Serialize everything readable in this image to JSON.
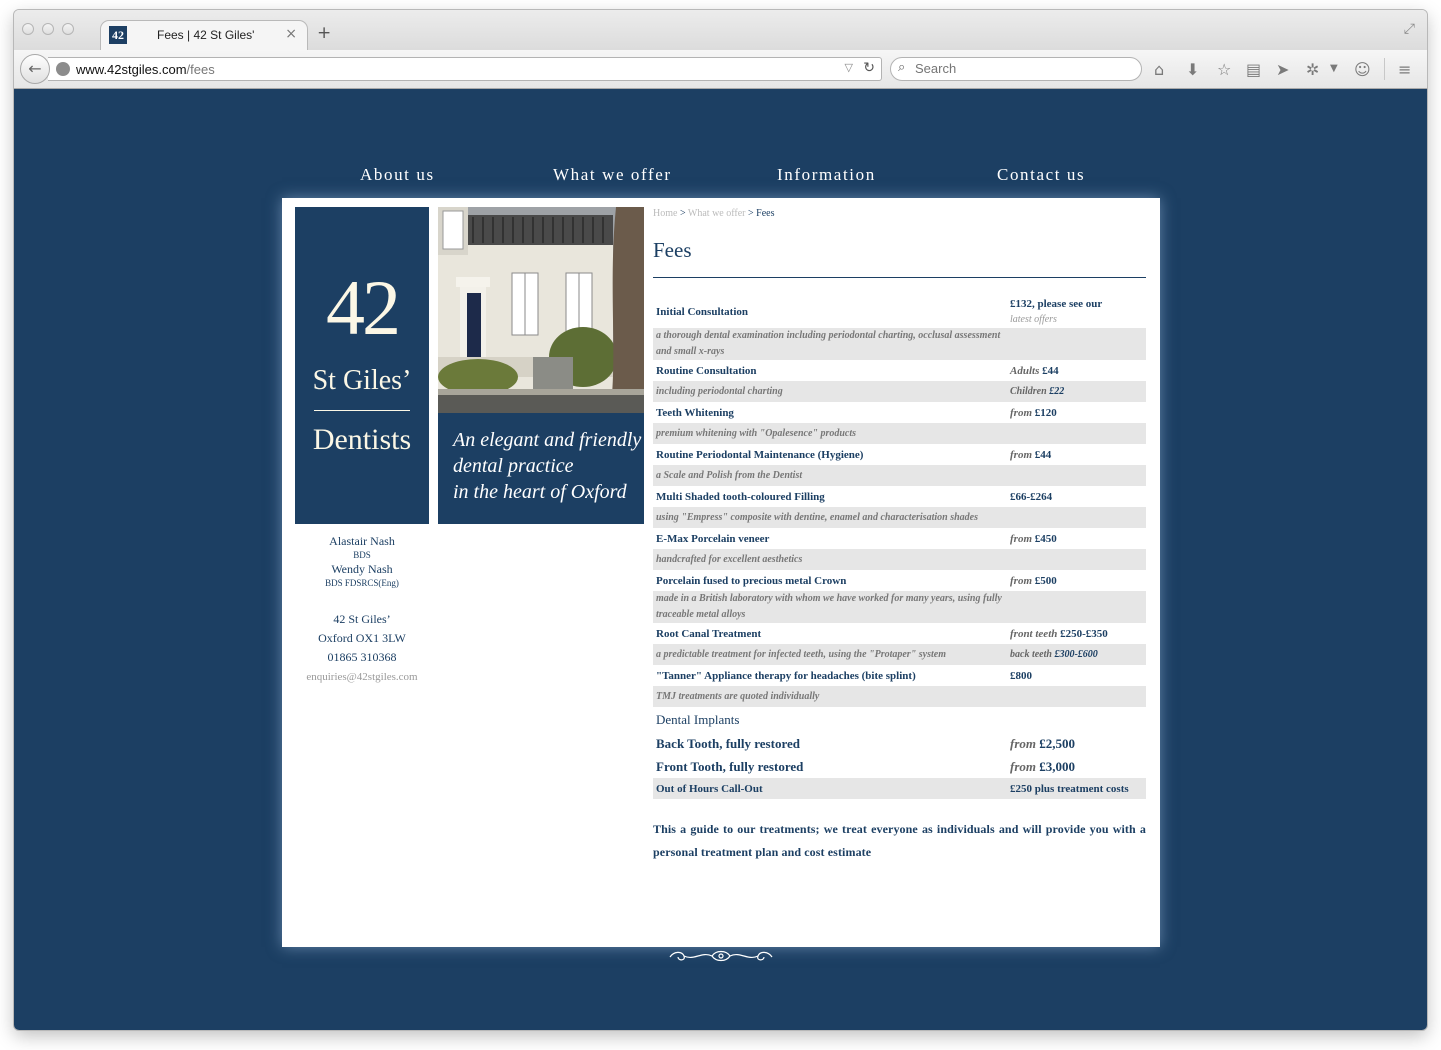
{
  "browser": {
    "tab_favicon_text": "42",
    "tab_title": "Fees | 42 St Giles'",
    "tab_close": "×",
    "new_tab": "+",
    "url_host": "www.42stgiles.com",
    "url_path": "/fees",
    "search_placeholder": "Search"
  },
  "nav": {
    "items": [
      "About us",
      "What we offer",
      "Information",
      "Contact us"
    ]
  },
  "logo": {
    "number": "42",
    "name": "St Giles’",
    "subtitle": "Dentists"
  },
  "tagline": {
    "line1": "An elegant and friendly",
    "line2": "dental practice",
    "line3": "in the heart of Oxford"
  },
  "contact": {
    "person1": "Alastair Nash",
    "person1_qual": "BDS",
    "person2": "Wendy Nash",
    "person2_qual": "BDS FDSRCS(Eng)",
    "address1": "42 St Giles’",
    "address2": "Oxford OX1 3LW",
    "phone": "01865 310368",
    "email": "enquiries@42stgiles.com"
  },
  "breadcrumb": {
    "home": "Home",
    "sep": " > ",
    "offer": "What we offer",
    "current": "Fees"
  },
  "page_title": "Fees",
  "fees": [
    {
      "kind": "item",
      "name": "Initial Consultation",
      "price": "£132, please see our",
      "price_note": "latest offers"
    },
    {
      "kind": "desc",
      "name": "a thorough dental examination including periodontal charting, occlusal assessment and small x-rays",
      "price": ""
    },
    {
      "kind": "item",
      "name": "Routine Consultation",
      "price_prefix": "Adults",
      "price": "£44"
    },
    {
      "kind": "desc",
      "name": "including periodontal charting",
      "price_prefix": "Children",
      "price": "£22"
    },
    {
      "kind": "item",
      "name": "Teeth Whitening",
      "price_prefix": "from",
      "price": "£120"
    },
    {
      "kind": "desc",
      "name": "premium whitening with \"Opalesence\" products",
      "price": ""
    },
    {
      "kind": "item",
      "name": "Routine Periodontal Maintenance (Hygiene)",
      "price_prefix": "from",
      "price": "£44"
    },
    {
      "kind": "desc",
      "name": "a Scale and Polish from the Dentist",
      "price": ""
    },
    {
      "kind": "item",
      "name": "Multi Shaded tooth-coloured Filling",
      "price": "£66-£264"
    },
    {
      "kind": "desc",
      "name": "using \"Empress\" composite with dentine, enamel and characterisation shades",
      "price": ""
    },
    {
      "kind": "item",
      "name": "E-Max Porcelain veneer",
      "price_prefix": "from",
      "price": "£450"
    },
    {
      "kind": "desc",
      "name": "handcrafted for excellent aesthetics",
      "price": ""
    },
    {
      "kind": "item",
      "name": "Porcelain fused to precious metal Crown",
      "price_prefix": "from",
      "price": "£500"
    },
    {
      "kind": "desc",
      "name": "made in a British laboratory with whom we have worked for many years, using fully traceable metal alloys",
      "price": ""
    },
    {
      "kind": "item",
      "name": "Root Canal Treatment",
      "price_prefix": "front teeth",
      "price": "£250-£350"
    },
    {
      "kind": "desc",
      "name": "a predictable treatment for infected teeth, using the \"Protaper\" system",
      "price_prefix": "back teeth",
      "price": "£300-£600"
    },
    {
      "kind": "item",
      "name": "\"Tanner\" Appliance therapy for headaches (bite splint)",
      "price": "£800"
    },
    {
      "kind": "desc",
      "name": "TMJ treatments are quoted individually",
      "price": ""
    },
    {
      "kind": "section",
      "name": "Dental Implants",
      "price": ""
    },
    {
      "kind": "big",
      "name": "Back Tooth, fully restored",
      "price_prefix": "from",
      "price": "£2,500"
    },
    {
      "kind": "big",
      "name": "Front Tooth, fully restored",
      "price_prefix": "from",
      "price": "£3,000"
    },
    {
      "kind": "desc-strong",
      "name": "Out of Hours Call-Out",
      "price": "£250 plus treatment costs"
    }
  ],
  "guide": "This a guide to our treatments; we treat everyone as individuals and will provide you with a personal treatment plan and cost estimate",
  "colors": {
    "brand_navy": "#1c3f63",
    "cream": "#fbf7e6",
    "row_grey": "#e6e6e6"
  }
}
